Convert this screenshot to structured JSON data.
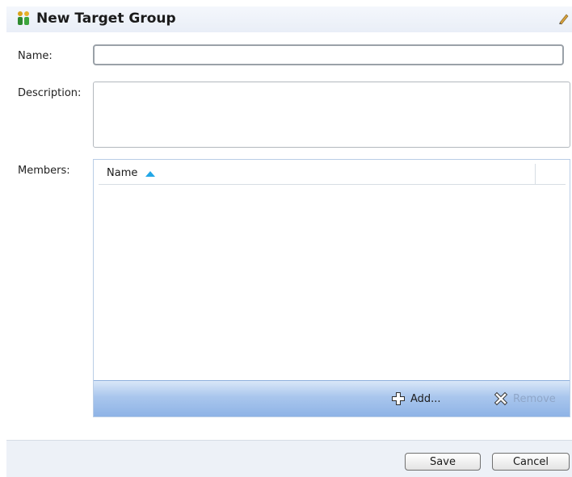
{
  "dialog": {
    "title": "New Target Group"
  },
  "form": {
    "name_label": "Name:",
    "name_value": "",
    "description_label": "Description:",
    "description_value": "",
    "members_label": "Members:"
  },
  "members": {
    "columns": [
      "Name"
    ],
    "sort": "ascending",
    "rows": [],
    "add_label": "Add...",
    "remove_label": "Remove"
  },
  "footer": {
    "save_label": "Save",
    "cancel_label": "Cancel"
  },
  "colors": {
    "accent": "#23a7e6",
    "toolbar": "#a9c6ed",
    "header_bg": "#e9eef7"
  }
}
